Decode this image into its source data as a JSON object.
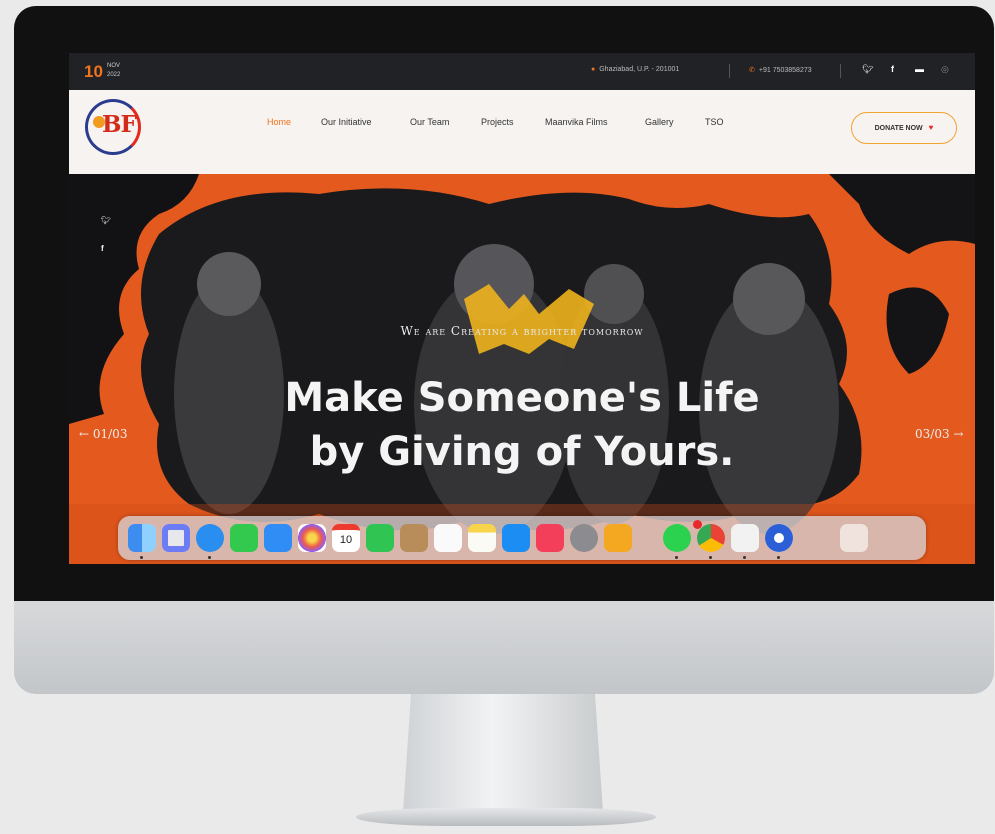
{
  "topbar": {
    "day": "10",
    "month": "NOV",
    "year": "2022",
    "location": "Ghaziabad, U.P. - 201001",
    "phone": "+91 7503858273"
  },
  "nav": {
    "logo_text": "BF",
    "items": [
      {
        "label": "Home",
        "active": true
      },
      {
        "label": "Our Initiative"
      },
      {
        "label": "Our Team"
      },
      {
        "label": "Projects"
      },
      {
        "label": "Maanvika Films"
      },
      {
        "label": "Gallery"
      },
      {
        "label": "TSO"
      }
    ],
    "donate_label": "DONATE NOW"
  },
  "hero": {
    "tagline": "We are Creating a brighter tomorrow",
    "headline_line1": "Make Someone's Life",
    "headline_line2": "by Giving of Yours.",
    "prev_label": "← 01/03",
    "next_label": "03/03 →"
  },
  "dock": {
    "calendar_day": "10",
    "icons": [
      "finder-icon",
      "launchpad-icon",
      "safari-icon",
      "messages-icon",
      "mail-icon",
      "photos-icon",
      "calendar-icon",
      "facetime-icon",
      "contacts-icon",
      "reminders-icon",
      "notes-icon",
      "app-store-icon",
      "music-icon",
      "settings-icon",
      "pages-icon",
      "whatsapp-icon",
      "chrome-icon",
      "textedit-icon",
      "word-icon",
      "trash-icon"
    ]
  },
  "colors": {
    "accent": "#f2731d",
    "topbar_bg": "#212226",
    "nav_bg": "#f6f3f1",
    "hero_orange": "#e45a1e"
  }
}
